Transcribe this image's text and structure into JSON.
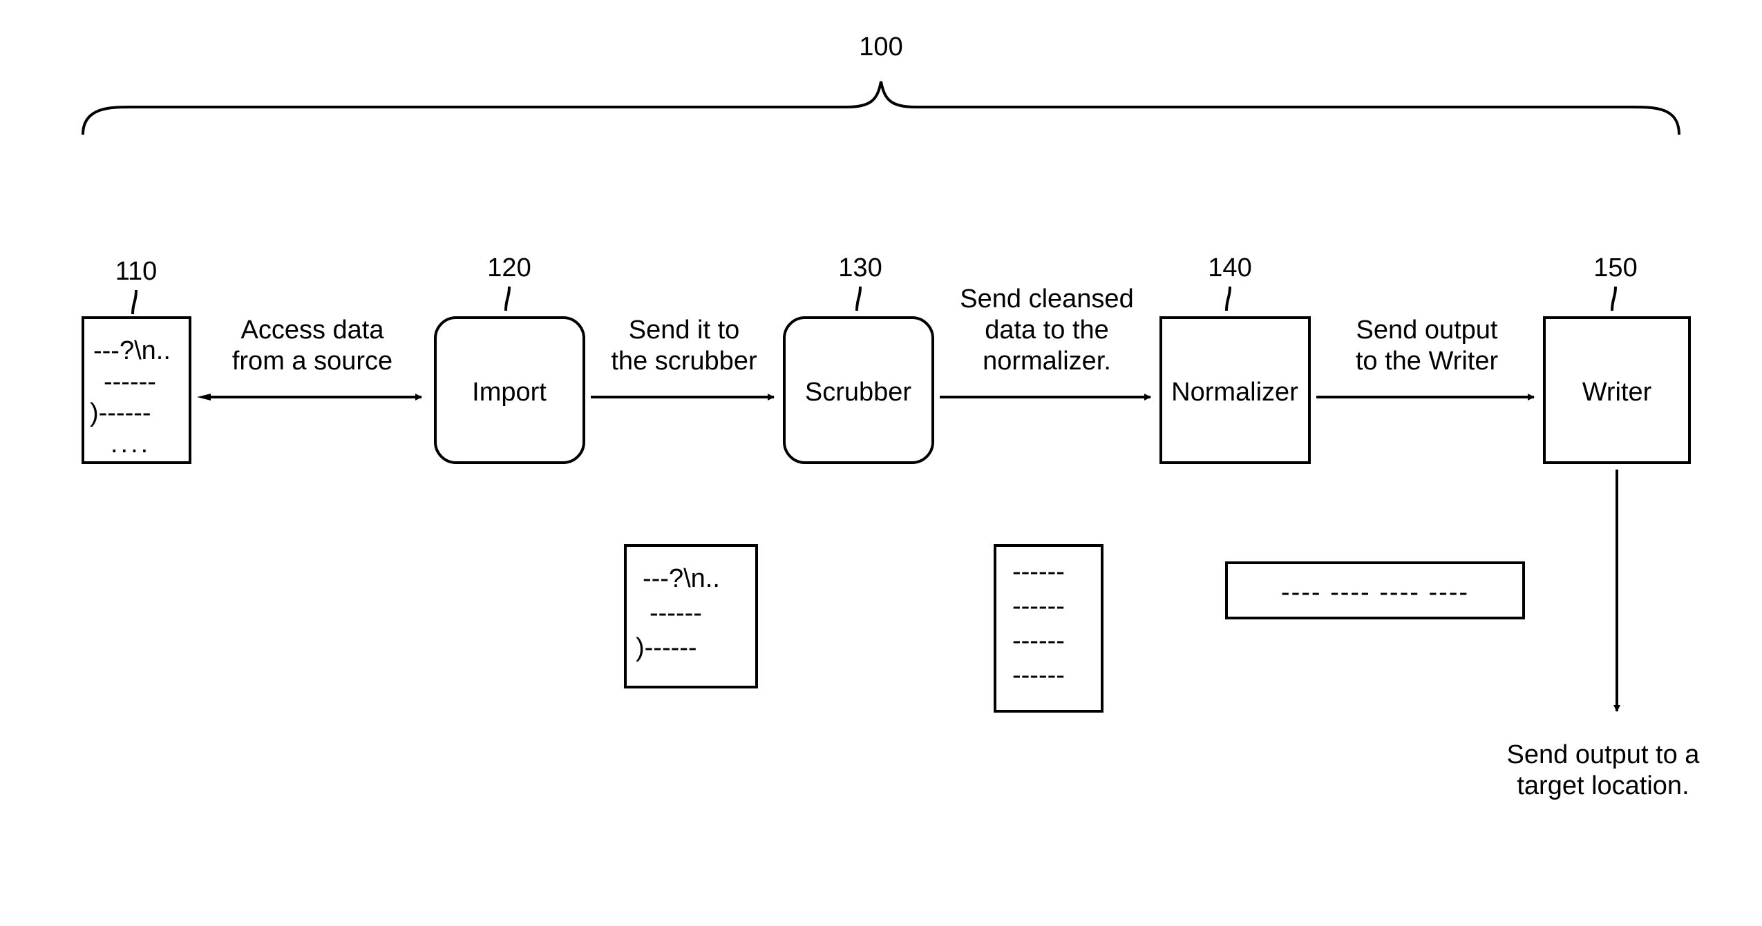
{
  "diagram": {
    "overall_ref": "100",
    "blocks": {
      "source": {
        "ref": "110",
        "line1": "---?\\n..",
        "line2": "------",
        "line3": ")------",
        "line4": "...."
      },
      "import": {
        "ref": "120",
        "label": "Import"
      },
      "scrubber": {
        "ref": "130",
        "label": "Scrubber"
      },
      "normalizer": {
        "ref": "140",
        "label": "Normalizer"
      },
      "writer": {
        "ref": "150",
        "label": "Writer"
      }
    },
    "arrows": {
      "a1": {
        "line1": "Access data",
        "line2": "from a source"
      },
      "a2": {
        "line1": "Send it to",
        "line2": "the scrubber"
      },
      "a3": {
        "line1": "Send cleansed",
        "line2": "data to the",
        "line3": "normalizer."
      },
      "a4": {
        "line1": "Send output",
        "line2": "to the Writer"
      },
      "a5": {
        "line1": "Send output to a",
        "line2": "target location."
      }
    },
    "sample_docs": {
      "doc1": {
        "line1": "---?\\n..",
        "line2": "------",
        "line3": ")------"
      },
      "doc2": {
        "line1": "------",
        "line2": "------",
        "line3": "------",
        "line4": "------"
      },
      "doc3": {
        "text": "---- ---- ---- ----"
      }
    }
  }
}
